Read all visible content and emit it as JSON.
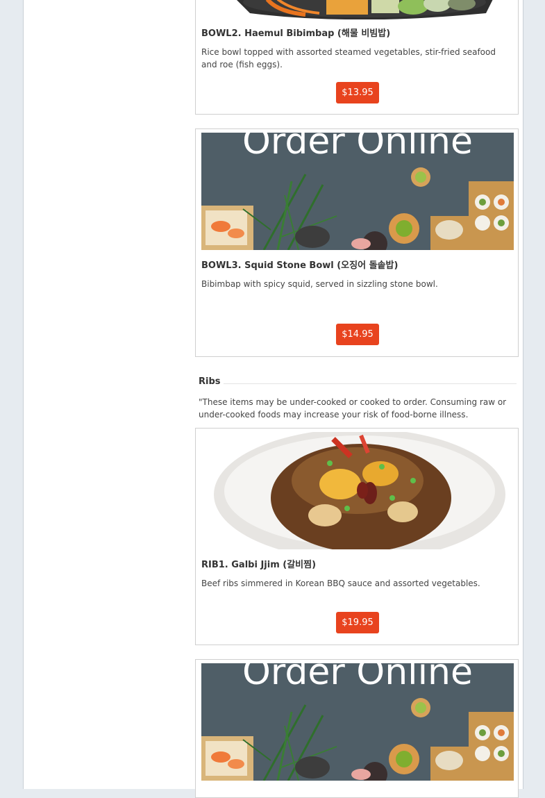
{
  "menu": {
    "items": [
      {
        "name": "BOWL2. Haemul Bibimbap (해물 비빔밥)",
        "description": "Rice bowl topped with assorted steamed vegetables, stir-fried seafood and roe (fish eggs).",
        "price": "$13.95"
      },
      {
        "name": "BOWL3. Squid Stone Bowl (오징어 돌솥밥)",
        "description": "Bibimbap with spicy squid, served in sizzling stone bowl.",
        "price": "$14.95",
        "image_text": "Order Online"
      },
      {
        "name": "RIB1. Galbi Jjim (갈비찜)",
        "description": "Beef ribs simmered in Korean BBQ sauce and assorted vegetables.",
        "price": "$19.95"
      },
      {
        "image_text": "Order Online"
      }
    ]
  },
  "section": {
    "title": "Ribs",
    "note": "\"These items may be under-cooked or cooked to order. Consuming raw or under-cooked foods may increase your risk of food-borne illness."
  },
  "colors": {
    "accent": "#e8431e",
    "page_bg": "#e6ebf0"
  }
}
